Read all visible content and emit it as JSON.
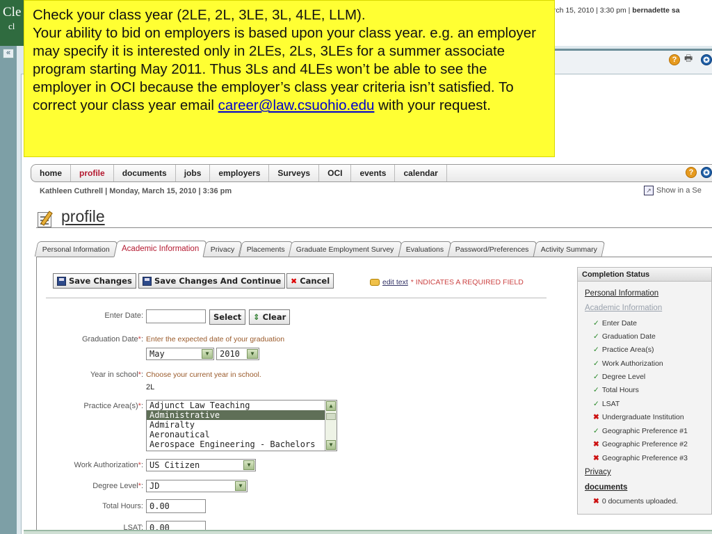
{
  "brand": {
    "line1": "Cle",
    "line2": "cl"
  },
  "top_status": {
    "datetime": "arch 15, 2010 | 3:30 pm |",
    "user": "bernadette sa"
  },
  "outer": {
    "collapse_glyph": "«"
  },
  "callout": {
    "line1": "Check your class year (2LE, 2L, 3LE, 3L, 4LE, LLM).",
    "line2": "Your ability to bid on employers is based upon your class year. e.g. an employer may specify it is interested only in 2LEs, 2Ls, 3LEs for a summer associate program starting May 2011. Thus 3Ls and 4LEs won’t be able to see the employer in OCI because the employer’s class year criteria isn’t satisfied. To correct your class year email",
    "email": "career@law.csuohio.edu",
    "line3": " with your request."
  },
  "nav": {
    "items": [
      "home",
      "profile",
      "documents",
      "jobs",
      "employers",
      "Surveys",
      "OCI",
      "events",
      "calendar"
    ],
    "active": "profile"
  },
  "user_line": "Kathleen Cuthrell | Monday, March 15, 2010 | 3:36 pm",
  "show_separate": "Show in a Se",
  "page_title": "profile",
  "tabs": [
    "Personal Information",
    "Academic Information",
    "Privacy",
    "Placements",
    "Graduate Employment Survey",
    "Evaluations",
    "Password/Preferences",
    "Activity Summary"
  ],
  "active_tab": "Academic Information",
  "actions": {
    "save": "Save Changes",
    "save_continue": "Save Changes And Continue",
    "cancel": "Cancel",
    "edit_text": "edit text",
    "required_note": "* INDICATES A REQUIRED FIELD"
  },
  "form": {
    "enter_date": {
      "label": "Enter Date:",
      "value": "",
      "select_btn": "Select",
      "clear_btn": "Clear"
    },
    "graduation_date": {
      "label": "Graduation Date",
      "hint": "Enter the expected date of your graduation",
      "month": "May",
      "year": "2010"
    },
    "year_in_school": {
      "label": "Year in school",
      "hint": "Choose your current year in school.",
      "value": "2L"
    },
    "practice_areas": {
      "label": "Practice Area(s)",
      "options": [
        "Adjunct Law Teaching",
        "Administrative",
        "Admiralty",
        "Aeronautical",
        "Aerospace Engineering - Bachelors"
      ],
      "selected": "Administrative"
    },
    "work_authorization": {
      "label": "Work Authorization",
      "value": "US Citizen"
    },
    "degree_level": {
      "label": "Degree Level",
      "value": "JD"
    },
    "total_hours": {
      "label": "Total Hours:",
      "value": "0.00"
    },
    "lsat": {
      "label": "LSAT:",
      "value": "0.00"
    }
  },
  "completion": {
    "title": "Completion Status",
    "personal": "Personal Information",
    "academic": "Academic Information",
    "items": [
      {
        "label": "Enter Date",
        "status": "ok"
      },
      {
        "label": "Graduation Date",
        "status": "ok"
      },
      {
        "label": "Practice Area(s)",
        "status": "ok"
      },
      {
        "label": "Work Authorization",
        "status": "ok"
      },
      {
        "label": "Degree Level",
        "status": "ok"
      },
      {
        "label": "Total Hours",
        "status": "ok"
      },
      {
        "label": "LSAT",
        "status": "ok"
      },
      {
        "label": "Undergraduate Institution",
        "status": "missing"
      },
      {
        "label": "Geographic Preference #1",
        "status": "ok"
      },
      {
        "label": "Geographic Preference #2",
        "status": "missing"
      },
      {
        "label": "Geographic Preference #3",
        "status": "missing"
      }
    ],
    "privacy": "Privacy",
    "documents": "documents",
    "documents_note": "0 documents uploaded."
  },
  "colors": {
    "callout_bg": "#ffff33",
    "active_red": "#b3182f",
    "ok_green": "#2a8a2a",
    "missing_red": "#cc1111"
  }
}
